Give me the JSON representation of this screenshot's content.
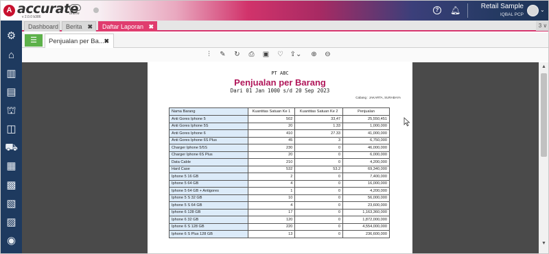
{
  "app": {
    "logo_letter": "A",
    "logo_name": "accurate",
    "logo_version": "v 2.0.0 b386",
    "logo_online": "online",
    "company": "Retail Sample",
    "user": "IQBAL PCP"
  },
  "tabs": [
    {
      "label": "Dashboard"
    },
    {
      "label": "Berita"
    },
    {
      "label": "Daftar Laporan"
    }
  ],
  "tab_count": "3 ∨",
  "subtab": {
    "label": "Penjualan per Ba..."
  },
  "report": {
    "company": "PT ABC",
    "title": "Penjualan per Barang",
    "date_range": "Dari 01 Jan 1000 s/d 20 Sep 2023",
    "branch": "Cabang : JAKARTA, SURABAYA",
    "columns": [
      "Nama Barang",
      "Kuantitas Satuan Ke 1",
      "Kuantitas Satuan Ke 2",
      "Penjualan"
    ],
    "rows": [
      [
        "Anti Gores Iphone 5",
        "502",
        "33,47",
        "25,550,451"
      ],
      [
        "Anti Gores Iphone 5S",
        "20",
        "1.33",
        "1,000,000"
      ],
      [
        "Anti Gores Iphone 6",
        "410",
        "27.33",
        "41,000,000"
      ],
      [
        "Anti Gores Iphone 6S Plus",
        "45",
        "3",
        "6,750,000"
      ],
      [
        "Charger Iphone 5/5S",
        "230",
        "0",
        "46,000,000"
      ],
      [
        "Charger Iphone 6S Plus",
        "20",
        "0",
        "6,000,000"
      ],
      [
        "Data Cable",
        "210",
        "0",
        "4,200,000"
      ],
      [
        "Hard Case",
        "532",
        "53.2",
        "69,340,000"
      ],
      [
        "Iphone 5 16 GB",
        "2",
        "0",
        "7,400,000"
      ],
      [
        "Iphone 5 64 GB",
        "4",
        "0",
        "16,000,000"
      ],
      [
        "Iphone 5 64 GB + Antigores",
        "1",
        "0",
        "4,200,000"
      ],
      [
        "Iphone 5 S 32 GB",
        "10",
        "0",
        "56,000,000"
      ],
      [
        "Iphone 5 S 64 GB",
        "4",
        "0",
        "23,600,000"
      ],
      [
        "Iphone 6 128 GB",
        "17",
        "0",
        "1,163,360,000"
      ],
      [
        "Iphone 6 32 GB",
        "120",
        "0",
        "1,872,000,000"
      ],
      [
        "Iphone 6 S 128 GB",
        "220",
        "0",
        "4,554,000,000"
      ],
      [
        "Iphone 6 S Plus 128 GB",
        "13",
        "0",
        "236,600,000"
      ]
    ]
  }
}
